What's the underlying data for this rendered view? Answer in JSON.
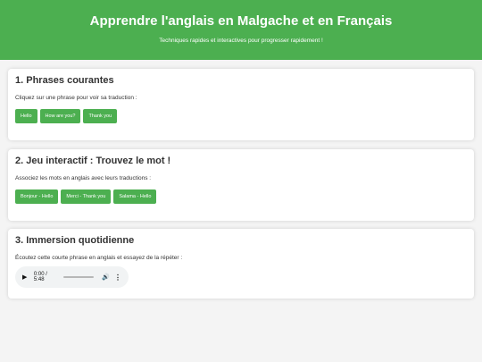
{
  "header": {
    "title": "Apprendre l'anglais en Malgache et en Français",
    "subtitle": "Techniques rapides et interactives pour progresser rapidement !",
    "accent_color": "#4caf50"
  },
  "sections": [
    {
      "title": "1. Phrases courantes",
      "instruction": "Cliquez sur une phrase pour voir sa traduction :",
      "buttons": [
        "Hello",
        "How are you?",
        "Thank you"
      ]
    },
    {
      "title": "2. Jeu interactif : Trouvez le mot !",
      "instruction": "Associez les mots en anglais avec leurs traductions :",
      "buttons": [
        "Bonjour - Hello",
        "Merci - Thank you",
        "Salama - Hello"
      ]
    },
    {
      "title": "3. Immersion quotidienne",
      "instruction": "Écoutez cette courte phrase en anglais et essayez de la répéter :",
      "audio": {
        "time": "0:00 / 5:48",
        "progress": 0,
        "play_icon": "play-icon",
        "volume_icon": "volume-icon",
        "more_icon": "more-options-icon"
      }
    }
  ]
}
